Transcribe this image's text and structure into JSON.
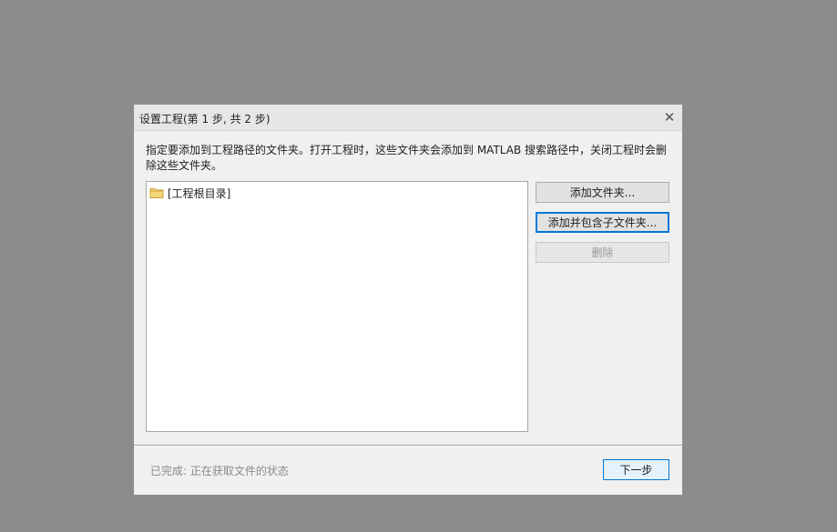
{
  "dialog": {
    "title": "设置工程(第 1 步, 共 2 步)",
    "close_glyph": "✕",
    "description": "指定要添加到工程路径的文件夹。打开工程时，这些文件夹会添加到 MATLAB 搜索路径中，关闭工程时会删除这些文件夹。"
  },
  "folder_list": {
    "items": [
      {
        "label": "[工程根目录]",
        "icon": "folder-icon"
      }
    ]
  },
  "buttons": {
    "add_folder": "添加文件夹...",
    "add_with_subfolders": "添加并包含子文件夹...",
    "remove": "删除",
    "next": "下一步"
  },
  "status": {
    "text": "已完成: 正在获取文件的状态"
  },
  "colors": {
    "accent": "#0078d7",
    "folder_fill": "#f5d77a",
    "folder_stroke": "#c9a33a"
  }
}
